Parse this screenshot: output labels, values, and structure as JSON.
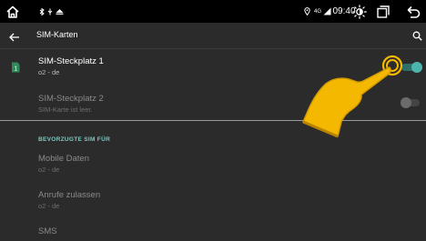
{
  "status_bar": {
    "icons": [
      "home-icon",
      "bluetooth-icon",
      "usb-icon",
      "eject-icon",
      "location-icon",
      "network-4g-icon",
      "signal-icon",
      "brightness-icon",
      "recent-apps-icon",
      "back-icon"
    ],
    "network": "4G",
    "time": "09:40"
  },
  "header": {
    "title": "SIM-Karten",
    "back_icon": "arrow-left-icon",
    "search_icon": "search-icon"
  },
  "sim_slots": [
    {
      "title": "SIM-Steckplatz 1",
      "subtitle": "o2 - de",
      "enabled": true,
      "toggle_on": true
    },
    {
      "title": "SIM-Steckplatz 2",
      "subtitle": "SIM-Karte ist leer.",
      "enabled": false,
      "toggle_on": false
    }
  ],
  "preferred": {
    "heading": "BEVORZUGTE SIM FÜR",
    "items": [
      {
        "title": "Mobile Daten",
        "subtitle": "o2 - de"
      },
      {
        "title": "Anrufe zulassen",
        "subtitle": "o2 - de"
      },
      {
        "title": "SMS",
        "subtitle": ""
      }
    ]
  },
  "colors": {
    "background": "#2b2b2b",
    "status_bar": "#000000",
    "accent": "#4db6ac",
    "sim_badge": "#2e8b57",
    "hand": "#f5b800"
  }
}
